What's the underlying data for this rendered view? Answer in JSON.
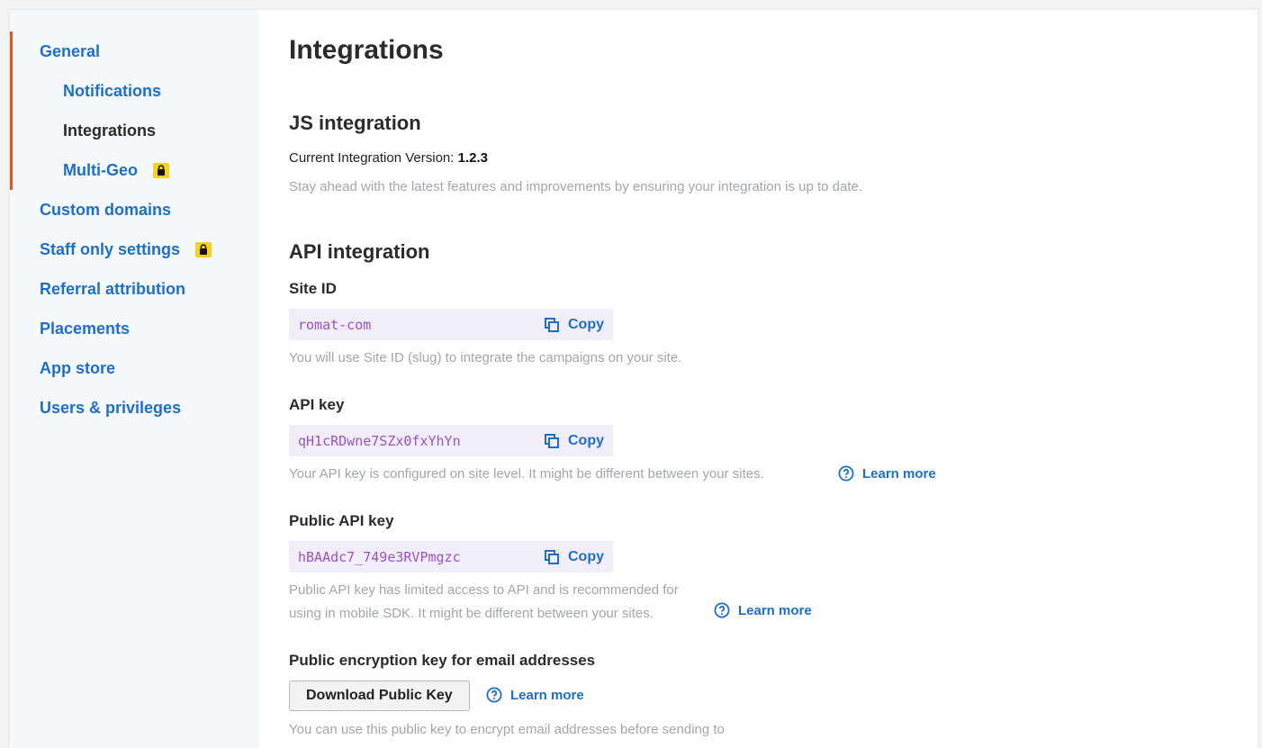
{
  "sidebar": {
    "items": [
      {
        "label": "General"
      },
      {
        "label": "Notifications"
      },
      {
        "label": "Integrations"
      },
      {
        "label": "Multi-Geo"
      },
      {
        "label": "Custom domains"
      },
      {
        "label": "Staff only settings"
      },
      {
        "label": "Referral attribution"
      },
      {
        "label": "Placements"
      },
      {
        "label": "App store"
      },
      {
        "label": "Users & privileges"
      }
    ],
    "active": "Integrations",
    "locked_items": [
      "Multi-Geo",
      "Staff only settings"
    ]
  },
  "page": {
    "title": "Integrations"
  },
  "js_integration": {
    "title": "JS integration",
    "version_label": "Current Integration Version:",
    "version": "1.2.3",
    "hint": "Stay ahead with the latest features and improvements by ensuring your integration is up to date."
  },
  "api_integration": {
    "title": "API integration",
    "site_id": {
      "label": "Site ID",
      "value": "romat-com",
      "copy_label": "Copy",
      "hint": "You will use Site ID (slug) to integrate the campaigns on your site."
    },
    "api_key": {
      "label": "API key",
      "value": "qH1cRDwne7SZx0fxYhYn",
      "copy_label": "Copy",
      "hint": "Your API key is configured on site level. It might be different between your sites.",
      "learn_more": "Learn more"
    },
    "public_api_key": {
      "label": "Public API key",
      "value": "hBAAdc7_749e3RVPmgzc",
      "copy_label": "Copy",
      "hint_line1": "Public API key has limited access to API and is recommended for",
      "hint_line2": "using in mobile SDK. It might be different between your sites.",
      "learn_more": "Learn more"
    },
    "encryption_key": {
      "label": "Public encryption key for email addresses",
      "button": "Download Public Key",
      "learn_more": "Learn more",
      "hint": "You can use this public key to encrypt email addresses before sending to"
    }
  },
  "colors": {
    "link": "#1d6fc9",
    "accent": "#e8541e",
    "lock_badge": "#f6d31a",
    "key_bg": "#f1eef9",
    "key_text": "#9b52c4",
    "hint": "#a0a7ae"
  }
}
